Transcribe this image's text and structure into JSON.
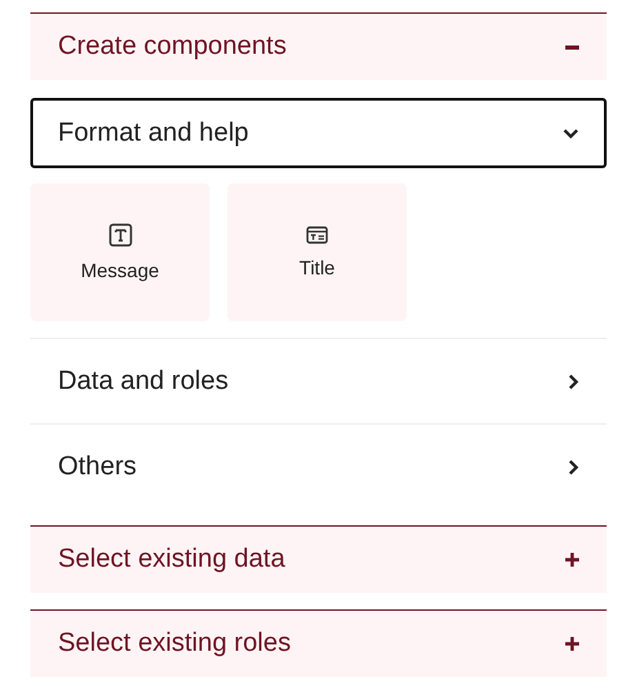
{
  "sections": [
    {
      "title": "Create components",
      "expanded": true,
      "groups": [
        {
          "title": "Format and help",
          "expanded": true,
          "focused": true,
          "items": [
            {
              "label": "Message",
              "kind": "message"
            },
            {
              "label": "Title",
              "kind": "title"
            }
          ]
        },
        {
          "title": "Data and roles",
          "expanded": false,
          "focused": false
        },
        {
          "title": "Others",
          "expanded": false,
          "focused": false
        }
      ]
    },
    {
      "title": "Select existing data",
      "expanded": false
    },
    {
      "title": "Select existing roles",
      "expanded": false
    }
  ]
}
